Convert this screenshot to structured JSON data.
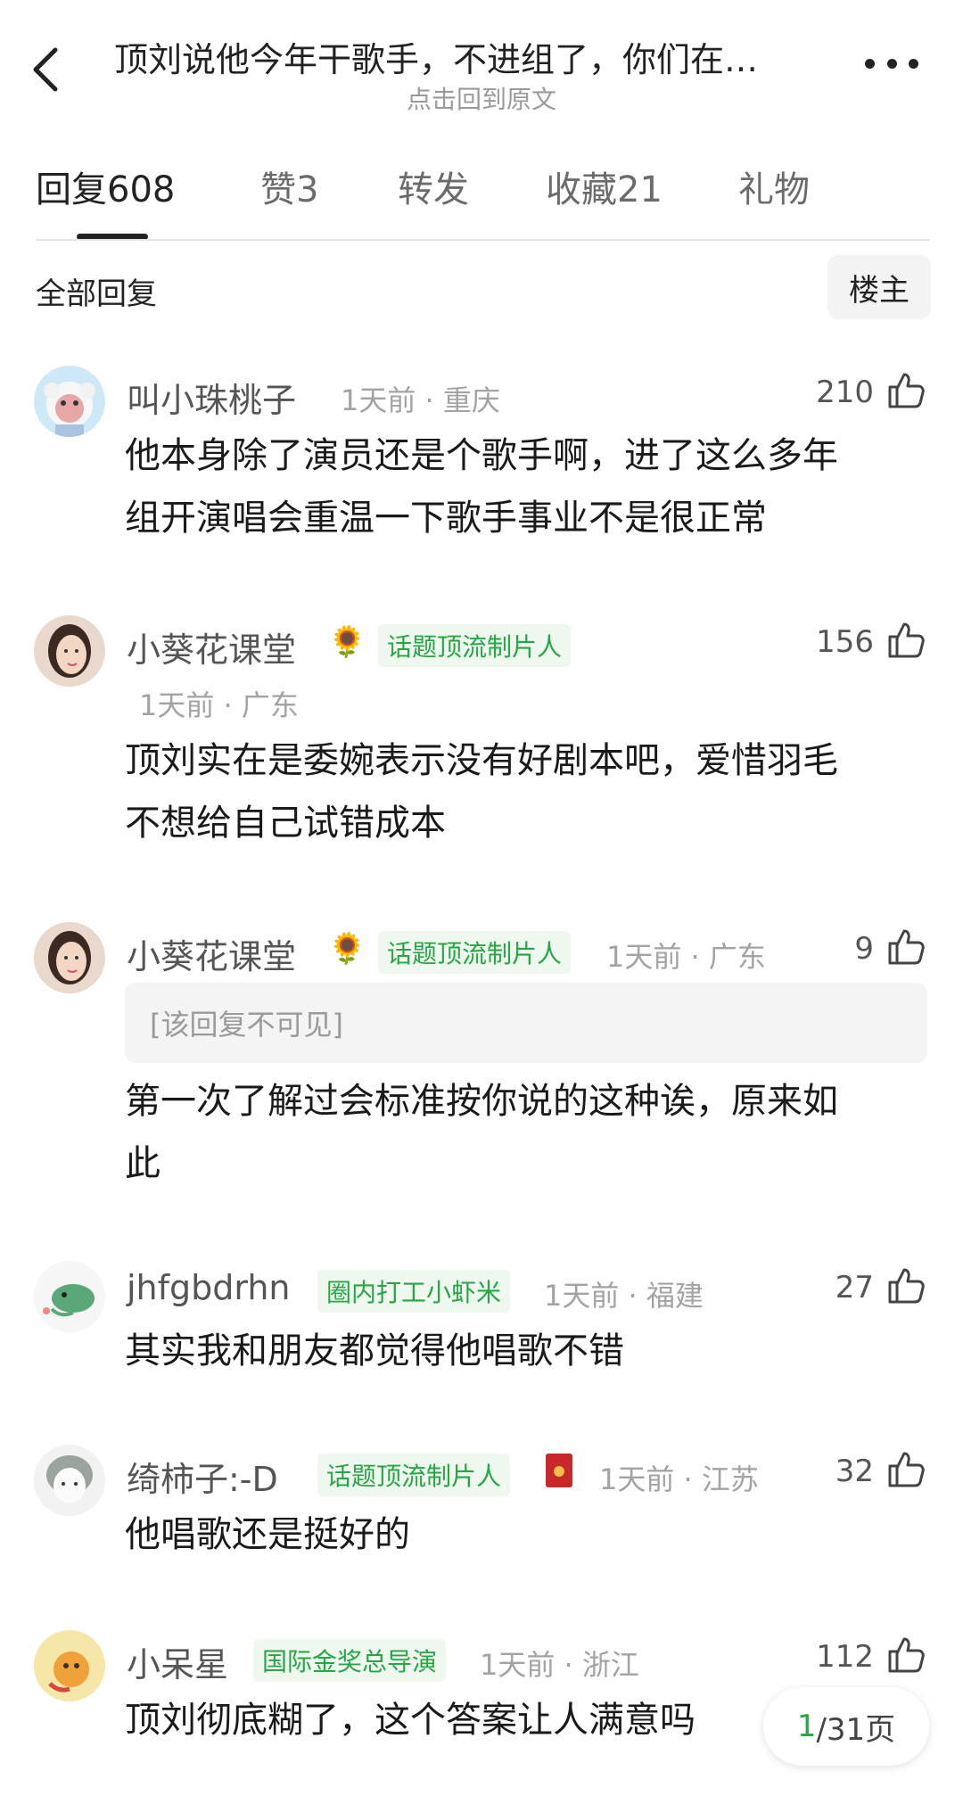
{
  "header": {
    "title": "顶刘说他今年干歌手，不进组了，你们在…",
    "subtitle": "点击回到原文"
  },
  "tabs": [
    {
      "label": "回复608"
    },
    {
      "label": "赞3"
    },
    {
      "label": "转发"
    },
    {
      "label": "收藏21"
    },
    {
      "label": "礼物"
    }
  ],
  "section": {
    "title": "全部回复",
    "op_button": "楼主"
  },
  "comments": [
    {
      "user": "叫小珠桃子",
      "meta": "1天前 · 重庆",
      "likes": "210",
      "lines": [
        "他本身除了演员还是个歌手啊，进了这么多年",
        "组开演唱会重温一下歌手事业不是很正常"
      ]
    },
    {
      "user": "小葵花课堂",
      "badge": "话题顶流制片人",
      "meta": "1天前 · 广东",
      "likes": "156",
      "lines": [
        "顶刘实在是委婉表示没有好剧本吧，爱惜羽毛",
        "不想给自己试错成本"
      ]
    },
    {
      "user": "小葵花课堂",
      "badge": "话题顶流制片人",
      "meta": "1天前 · 广东",
      "likes": "9",
      "quote": "[该回复不可见]",
      "lines": [
        "第一次了解过会标准按你说的这种诶，原来如",
        "此"
      ]
    },
    {
      "user": "jhfgbdrhn",
      "badge": "圈内打工小虾米",
      "meta": "1天前 · 福建",
      "likes": "27",
      "lines": [
        "其实我和朋友都觉得他唱歌不错"
      ]
    },
    {
      "user": "绮柿子:-D",
      "badge": "话题顶流制片人",
      "meta": "1天前 · 江苏",
      "likes": "32",
      "lines": [
        "他唱歌还是挺好的"
      ]
    },
    {
      "user": "小呆星",
      "badge": "国际金奖总导演",
      "meta": "1天前 · 浙江",
      "likes": "112",
      "lines": [
        "顶刘彻底糊了，这个答案让人满意吗"
      ]
    }
  ],
  "pagination": {
    "current": "1",
    "total": "/31页"
  },
  "icons": {
    "back": "chevron-left-icon",
    "more": "more-dots-icon",
    "like": "thumbs-up-icon",
    "sunflower": "sunflower-emoji",
    "red_envelope": "red-envelope-icon"
  },
  "colors": {
    "badge_green": "#27a645",
    "badge_bg": "#eef8ef"
  }
}
